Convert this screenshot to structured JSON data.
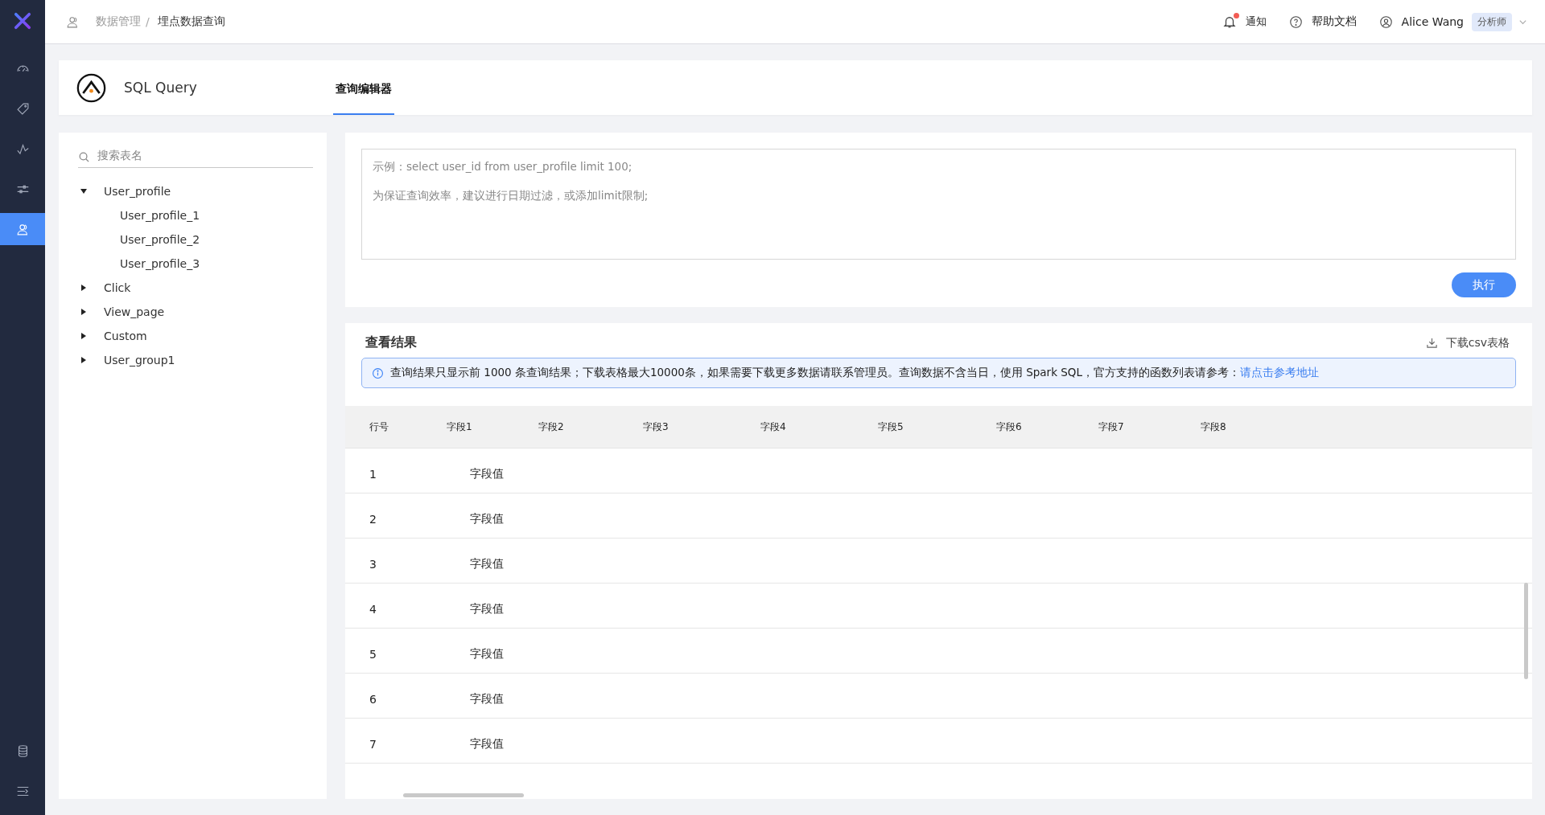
{
  "nav": {
    "items": [
      {
        "selected": false
      },
      {
        "selected": false
      },
      {
        "selected": false
      },
      {
        "selected": false
      },
      {
        "selected": true
      }
    ],
    "bottom_items": [
      {
        "selected": false
      },
      {
        "selected": false
      }
    ]
  },
  "header": {
    "breadcrumb": [
      {
        "label": "数据管理",
        "current": false
      },
      {
        "label": "埋点数据查询",
        "current": true
      }
    ],
    "separator": "/",
    "notify": {
      "label": "通知",
      "unread": true
    },
    "help": "帮助文档",
    "user": "Alice Wang",
    "role": "分析师"
  },
  "app": {
    "title": "SQL Query",
    "tabs": [
      {
        "label": "查询编辑器",
        "selected": true
      }
    ]
  },
  "tree": {
    "search": {
      "placeholder": "搜索表名"
    },
    "items": [
      {
        "label": "User_profile",
        "expanded": true,
        "children": [
          {
            "label": "User_profile_1"
          },
          {
            "label": "User_profile_2"
          },
          {
            "label": "User_profile_3"
          }
        ]
      },
      {
        "label": "Click",
        "expanded": false
      },
      {
        "label": "View_page",
        "expanded": false
      },
      {
        "label": "Custom",
        "expanded": false
      },
      {
        "label": "User_group1",
        "expanded": false
      }
    ]
  },
  "editor": {
    "placeholder": "示例：select user_id from user_profile limit 100;\n\n为保证查询效率，建议进行日期过滤，或添加limit限制;",
    "run_button": "执行"
  },
  "results": {
    "title": "查看结果",
    "download": "下载csv表格",
    "notice": "查询结果只显示前 1000 条查询结果；下载表格最大10000条，如果需要下载更多数据请联系管理员。查询数据不含当日，使用 Spark SQL，官方支持的函数列表请参考：",
    "notice_link": "请点击参考地址",
    "columns": [
      "行号",
      "字段1",
      "字段2",
      "字段3",
      "字段4",
      "字段5",
      "字段6",
      "字段7",
      "字段8"
    ],
    "rows": [
      [
        "1",
        "字段值"
      ],
      [
        "2",
        "字段值"
      ],
      [
        "3",
        "字段值"
      ],
      [
        "4",
        "字段值"
      ],
      [
        "5",
        "字段值"
      ],
      [
        "6",
        "字段值"
      ],
      [
        "7",
        "字段值"
      ]
    ]
  }
}
